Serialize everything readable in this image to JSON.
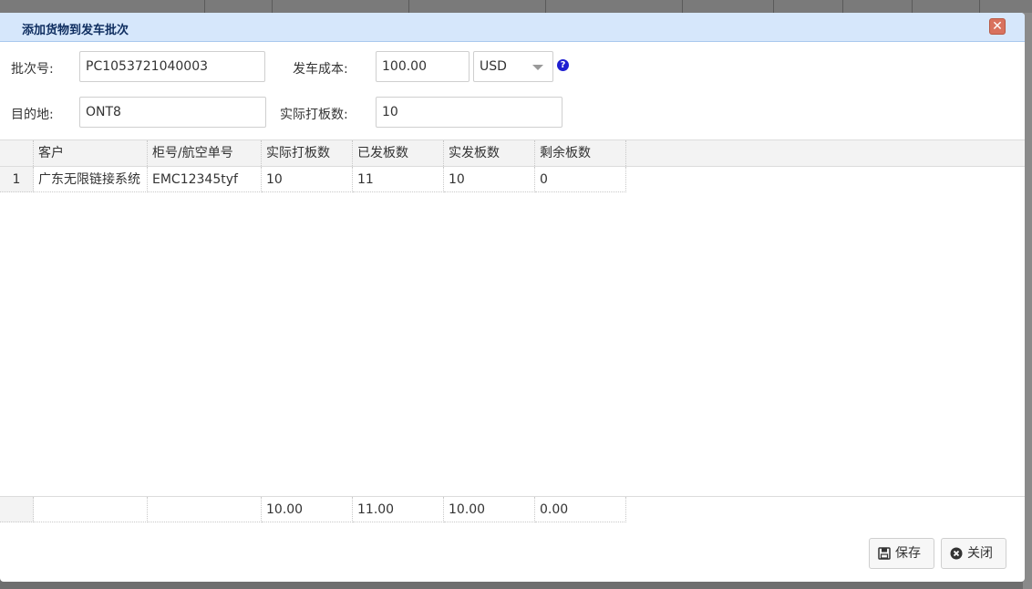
{
  "dialog": {
    "title": "添加货物到发车批次",
    "close_glyph": "✕"
  },
  "form": {
    "batch_label": "批次号:",
    "batch_value": "PC1053721040003",
    "cost_label": "发车成本:",
    "cost_value": "100.00",
    "currency_value": "USD",
    "dest_label": "目的地:",
    "dest_value": "ONT8",
    "pallets_label": "实际打板数:",
    "pallets_value": "10",
    "help_glyph": "?"
  },
  "grid": {
    "columns": [
      "客户",
      "柜号/航空单号",
      "实际打板数",
      "已发板数",
      "实发板数",
      "剩余板数"
    ],
    "rows": [
      [
        "1",
        "广东无限链接系统",
        "EMC12345tyf",
        "10",
        "11",
        "10",
        "0"
      ]
    ],
    "footer": [
      "",
      "",
      "",
      "10.00",
      "11.00",
      "10.00",
      "0.00"
    ]
  },
  "buttons": {
    "save_label": "保存",
    "close_label": "关闭"
  },
  "colors": {
    "titlebar": "#d6e7fb",
    "close_button": "#d9725e",
    "help_icon": "#1f1fd1"
  },
  "icons": {
    "save": "floppy-disk-icon",
    "close": "times-circle-icon",
    "help": "question-circle-icon"
  }
}
